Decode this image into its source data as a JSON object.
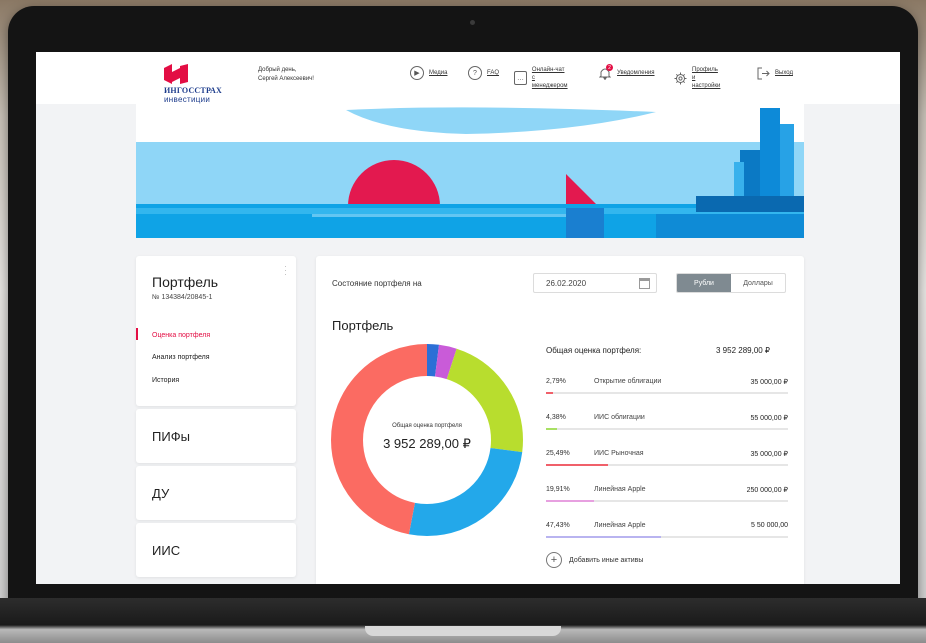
{
  "app": {
    "brand_line1": "ИНГОССТРАХ",
    "brand_line2": "инвестиции",
    "greeting_line1": "Добрый день,",
    "greeting_line2": "Сергей Алексеевич!"
  },
  "nav": [
    {
      "label": "Медиа",
      "icon": "play-icon"
    },
    {
      "label": "FAQ",
      "icon": "question-icon"
    },
    {
      "label_line1": "Онлайн-чат",
      "label_line2": "с менеджером",
      "icon": "chat-icon"
    },
    {
      "label": "Уведомления",
      "icon": "bell-icon",
      "badge": "2"
    },
    {
      "label_line1": "Профиль",
      "label_line2": "и настройки",
      "icon": "gear-icon"
    },
    {
      "label": "Выход",
      "icon": "logout-icon"
    }
  ],
  "sidebar": {
    "title": "Портфель",
    "number": "№ 134384/20845-1",
    "links": [
      "Оценка портфеля",
      "Анализ портфеля",
      "История"
    ],
    "sections": [
      "ПИФы",
      "ДУ",
      "ИИС"
    ]
  },
  "main": {
    "state_label": "Состояние портфеля на",
    "date": "26.02.2020",
    "currency_options": [
      "Рубли",
      "Доллары"
    ],
    "currency_selected": "Рубли",
    "portfolio_title": "Портфель",
    "donut_label": "Общая оценка портфеля",
    "donut_value": "3 952 289,00 ₽",
    "total_label": "Общая оценка портфеля:",
    "total_value": "3 952 289,00 ₽",
    "add_label": "Добавить иные активы"
  },
  "holdings": [
    {
      "pct": "2,79%",
      "name": "Открытие облигации",
      "amount": "35 000,00 ₽",
      "share": 0.0279,
      "color": "#f0606a"
    },
    {
      "pct": "4,38%",
      "name": "ИИС облигации",
      "amount": "55 000,00 ₽",
      "share": 0.0438,
      "color": "#a8e063"
    },
    {
      "pct": "25,49%",
      "name": "ИИС Рыночная",
      "amount": "35 000,00 ₽",
      "share": 0.2549,
      "color": "#f0606a"
    },
    {
      "pct": "19,91%",
      "name": "Линейная Apple",
      "amount": "250 000,00 ₽",
      "share": 0.1991,
      "color": "#e7a0e0"
    },
    {
      "pct": "47,43%",
      "name": "Линейная Apple",
      "amount": "5 50 000,00",
      "share": 0.4743,
      "color": "#b9b4f0"
    }
  ],
  "donut_segments": [
    {
      "share": 0.02,
      "color": "#2c6fd6"
    },
    {
      "share": 0.03,
      "color": "#c95bd8"
    },
    {
      "share": 0.22,
      "color": "#b8dd2e"
    },
    {
      "share": 0.26,
      "color": "#23a8ea"
    },
    {
      "share": 0.47,
      "color": "#fb6b62"
    }
  ]
}
